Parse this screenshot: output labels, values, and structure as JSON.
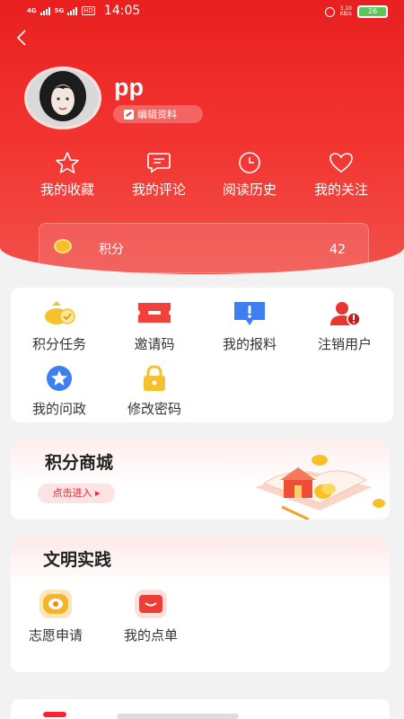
{
  "status_bar": {
    "network_1": "4G",
    "network_2": "5G",
    "hd": "HD",
    "time": "14:05",
    "speed_value": "3.10",
    "speed_unit": "KB/s",
    "battery": "26"
  },
  "profile": {
    "username": "pp",
    "edit_label": "编辑资料"
  },
  "quick_links": [
    {
      "label": "我的收藏",
      "icon": "star-icon"
    },
    {
      "label": "我的评论",
      "icon": "comment-icon"
    },
    {
      "label": "阅读历史",
      "icon": "clock-icon"
    },
    {
      "label": "我的关注",
      "icon": "heart-icon"
    }
  ],
  "points": {
    "label": "积分",
    "value": "42"
  },
  "functions": [
    {
      "label": "积分任务",
      "icon": "points-task-icon"
    },
    {
      "label": "邀请码",
      "icon": "invite-ticket-icon"
    },
    {
      "label": "我的报料",
      "icon": "report-alert-icon"
    },
    {
      "label": "注销用户",
      "icon": "deregister-user-icon"
    },
    {
      "label": "我的问政",
      "icon": "star-badge-icon"
    },
    {
      "label": "修改密码",
      "icon": "lock-icon"
    }
  ],
  "mall": {
    "title": "积分商城",
    "button": "点击进入 ▸"
  },
  "civilization": {
    "title": "文明实践",
    "items": [
      {
        "label": "志愿申请",
        "icon": "volunteer-icon"
      },
      {
        "label": "我的点单",
        "icon": "order-icon"
      }
    ]
  },
  "colors": {
    "primary_red": "#f33632",
    "coin_gold": "#f6c02a"
  }
}
